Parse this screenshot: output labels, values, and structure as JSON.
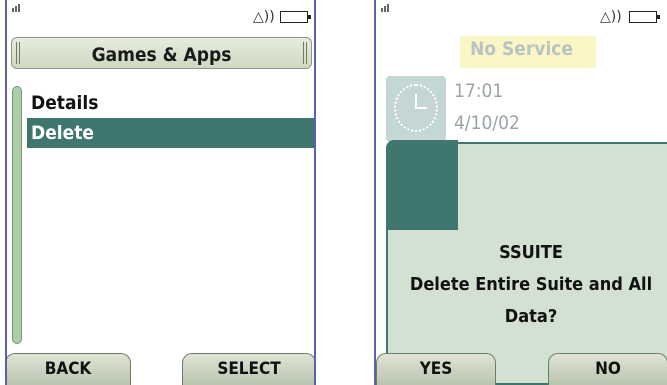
{
  "left_screen": {
    "title": "Games & Apps",
    "menu_items": [
      "Details",
      "Delete"
    ],
    "selected_index": 1,
    "softkeys": {
      "left": "BACK",
      "right": "SELECT"
    }
  },
  "right_screen": {
    "network_status": "No Service",
    "time": "17:01",
    "date": "4/10/02",
    "dialog": {
      "title": "SSUITE",
      "message_line1": "Delete Entire Suite and All",
      "message_line2": "Data?"
    },
    "softkeys": {
      "left": "YES",
      "right": "NO"
    }
  },
  "colors": {
    "accent": "#3f7770",
    "dialog_bg": "#d3e1d2",
    "frame": "#5a5fb0",
    "softkey": "#c7d0bc"
  },
  "icons": [
    "signal-icon",
    "alert-icon",
    "battery-icon",
    "clock-icon",
    "scrollbar"
  ]
}
